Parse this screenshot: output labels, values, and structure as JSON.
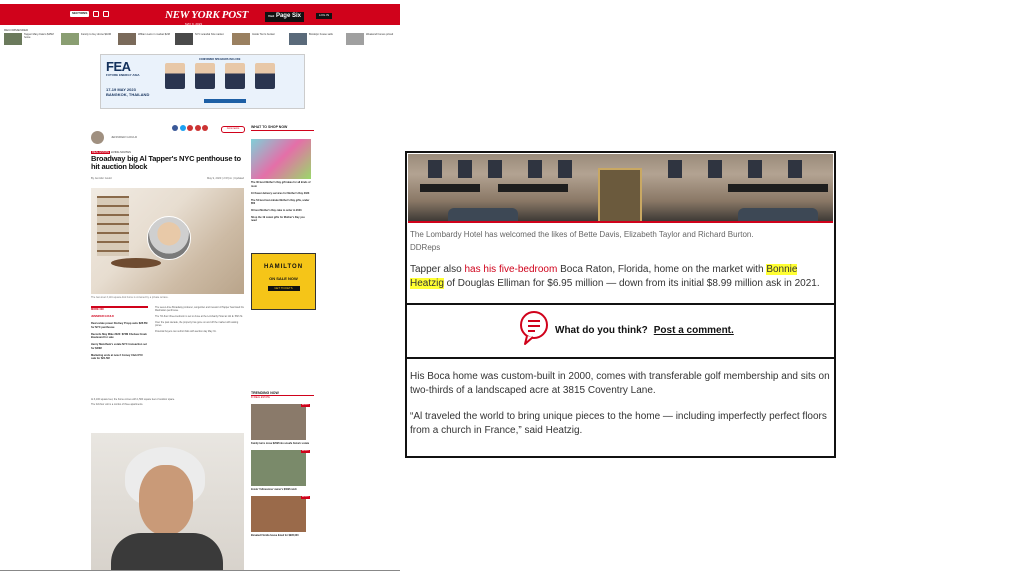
{
  "mini_page": {
    "header": {
      "sections_label": "SECTIONS",
      "logo": "NEW YORK POST",
      "page_six": "Page Six",
      "page_six_prefix": "Visit",
      "login_label": "LOG IN",
      "date": "MAY 9, 2023"
    },
    "trending_label": "RECOMMENDED",
    "strip_items": [
      "Tapper Mary-Kate's $25M home",
      "Family to buy drone $10M",
      "William Lazo in market $2M",
      "NYC scandal hits market",
      "Inside Tom's bunker",
      "Brooklyn house sells",
      "Weekend homes priced"
    ],
    "ad": {
      "brand": "FEA",
      "brand_sub": "FUTURE ENERGY ASIA",
      "dates": "17-19 MAY 2023 BANGKOK, THAILAND",
      "speakers_title": "CONFIRMED SPEAKERS INCLUDE",
      "cta": "REGISTER AS A DELEGATE"
    },
    "article": {
      "author_name": "JENNIFER GOULD",
      "comment_label": "Comments",
      "tags": [
        "REAL ESTATE",
        "LIVING",
        "SOUTHS"
      ],
      "headline": "Broadway big Al Tapper's NYC penthouse to hit auction block",
      "byline": "By Jennifer Gould",
      "timestamp": "May 9, 2023 | 2:07pm | Updated",
      "photo_caption": "The two-level 3,110-square-foot home is crowned by a private terrace.",
      "sidebox_label": "MORE ON:",
      "sidebox_title": "JENNIFER GOULD",
      "sidebox_items": [
        "Real estate power Rodney Propp asks $28.5M for NYC penthouse",
        "Records May Mike 2023: $72M Chelsea Creek Boulevard for sale",
        "Henry Mendham's estate NYC transaction set for $20M",
        "Marketing ends at new 2 Comey Club NYC sale for $21.5M"
      ],
      "body_paras": [
        "The seven-time Broadway producer, songwriter and investor Al Tapper has listed his Manhattan penthouse.",
        "The 7th-floor three-bedroom is set to close at the Lombardy Hotel at 111 E. 56th St.",
        "Over the past decade, the property has gone on and off the market with asking prices.",
        "Potential buyers can submit bids with auction day May 31."
      ],
      "body_paras2": [
        "At 3,100 square feet, the home comes with 1,500 square feet of outdoor space.",
        "The full-floor unit is a combo of three apartments."
      ]
    },
    "sidebar": {
      "shop_title": "WHAT TO SHOP NOW",
      "shop_items": [
        "The 30 best Mother's Day gift ideas for all kinds of mom",
        "10 flower delivery services for Mother's Day 2023",
        "The 54 best last-minute Mother's Day gifts, under $50",
        "30 best Mother's Day cake to order in 2023",
        "Shop the 19 cutest gifts for Mother's Day you need"
      ],
      "ad2": {
        "title": "HAMILTON",
        "line": "ON SALE NOW",
        "cta": "GET TICKETS"
      },
      "trending_title": "TRENDING NOW",
      "trending_sub": "IN REAL ESTATE",
      "trending_badge": "ALERT",
      "trending_items": [
        "Family turns move $20M into unsafe historic estate",
        "Inside 'Yellowstone' owner's $30M ranch",
        "Elevated Florida house listed for $995,000"
      ]
    }
  },
  "excerpt": {
    "caption": "The Lombardy Hotel has welcomed the likes of Bette Davis, Elizabeth Taylor and Richard Burton.",
    "credit": "DDReps",
    "para1_start": "Tapper also ",
    "para1_link": "has his five-bedroom",
    "para1_mid": " Boca Raton, Florida, home on the market with ",
    "para1_highlight": "Bonnie Heatzig",
    "para1_end": " of Douglas Elliman for $6.95 million — down from its initial $8.99 million ask in 2021.",
    "cta_question": "What do you think?",
    "cta_link": "Post a comment.",
    "para2": "His Boca home was custom-built in 2000, comes with transferable golf membership and sits on two-thirds of a landscaped acre at 3815 Coventry Lane.",
    "para3": "“Al traveled the world to bring unique pieces to the home — including imperfectly perfect floors from a church in France,” said Heatzig."
  },
  "colors": {
    "brand_red": "#d0021b",
    "highlight_yellow": "#ffff33"
  },
  "icons": [
    "menu-icon",
    "search-icon",
    "share-icon",
    "comment-bubble-icon"
  ]
}
